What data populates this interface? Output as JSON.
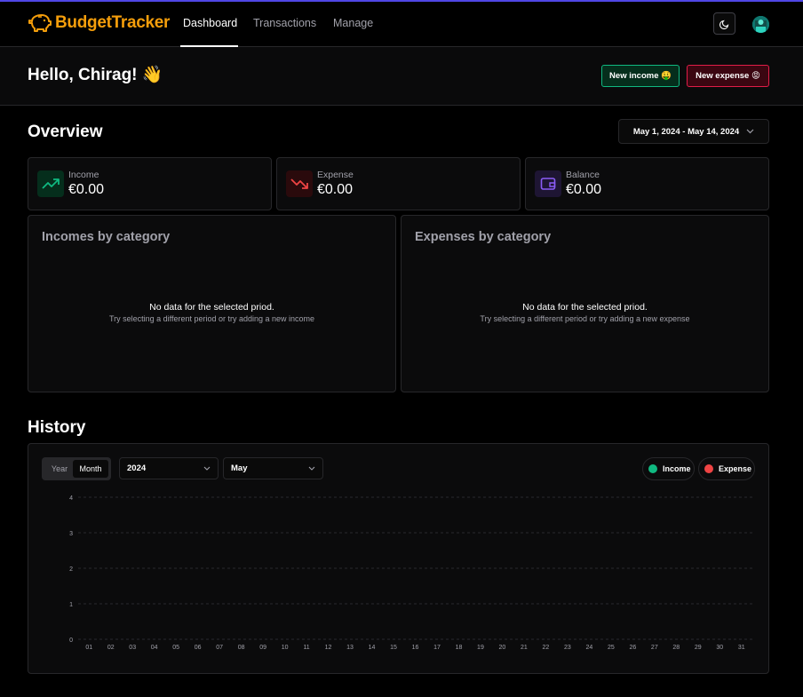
{
  "app": {
    "name": "BudgetTracker",
    "logo_icon": "piggy-bank-icon",
    "accent": "#f59e0b"
  },
  "nav": {
    "items": [
      {
        "label": "Dashboard",
        "active": true
      },
      {
        "label": "Transactions",
        "active": false
      },
      {
        "label": "Manage",
        "active": false
      }
    ]
  },
  "header": {
    "greeting": "Hello, Chirag! 👋",
    "new_income_label": "New income 🤑",
    "new_expense_label": "New expense 😡"
  },
  "overview": {
    "title": "Overview",
    "date_range": "May 1, 2024 - May 14, 2024",
    "stats": [
      {
        "label": "Income",
        "value": "€0.00",
        "icon": "trending-up-icon",
        "color": "#10b981"
      },
      {
        "label": "Expense",
        "value": "€0.00",
        "icon": "trending-down-icon",
        "color": "#ef4444"
      },
      {
        "label": "Balance",
        "value": "€0.00",
        "icon": "wallet-icon",
        "color": "#8b5cf6"
      }
    ]
  },
  "incomes_card": {
    "title": "Incomes by category",
    "empty": "No data for the selected priod.",
    "hint": "Try selecting a different period or try adding a new income"
  },
  "expenses_card": {
    "title": "Expenses by category",
    "empty": "No data for the selected priod.",
    "hint": "Try selecting a different period or try adding a new expense"
  },
  "history": {
    "title": "History",
    "timeframe_options": [
      "Year",
      "Month"
    ],
    "timeframe_selected": "Month",
    "year": "2024",
    "month": "May",
    "legend": [
      {
        "label": "Income",
        "color": "#10b981"
      },
      {
        "label": "Expense",
        "color": "#ef4444"
      }
    ]
  },
  "chart_data": {
    "type": "bar",
    "categories": [
      "01",
      "02",
      "03",
      "04",
      "05",
      "06",
      "07",
      "08",
      "09",
      "10",
      "11",
      "12",
      "13",
      "14",
      "15",
      "16",
      "17",
      "18",
      "19",
      "20",
      "21",
      "22",
      "23",
      "24",
      "25",
      "26",
      "27",
      "28",
      "29",
      "30",
      "31"
    ],
    "series": [
      {
        "name": "Income",
        "values": [
          0,
          0,
          0,
          0,
          0,
          0,
          0,
          0,
          0,
          0,
          0,
          0,
          0,
          0,
          0,
          0,
          0,
          0,
          0,
          0,
          0,
          0,
          0,
          0,
          0,
          0,
          0,
          0,
          0,
          0,
          0
        ]
      },
      {
        "name": "Expense",
        "values": [
          0,
          0,
          0,
          0,
          0,
          0,
          0,
          0,
          0,
          0,
          0,
          0,
          0,
          0,
          0,
          0,
          0,
          0,
          0,
          0,
          0,
          0,
          0,
          0,
          0,
          0,
          0,
          0,
          0,
          0,
          0
        ]
      }
    ],
    "yticks": [
      "0",
      "1",
      "2",
      "3",
      "4"
    ],
    "ylim": [
      0,
      4
    ],
    "grid": true
  }
}
